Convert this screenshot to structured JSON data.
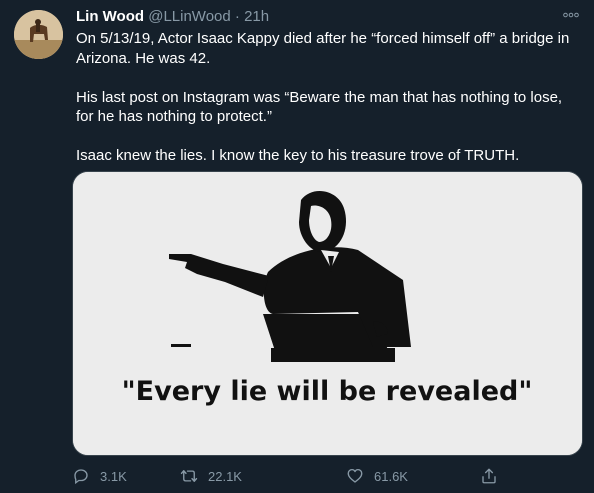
{
  "tweet": {
    "author_name": "Lin Wood",
    "author_handle": "@LLinWood",
    "separator": "·",
    "time": "21h",
    "paragraphs": [
      "On 5/13/19, Actor Isaac Kappy died after he “forced himself off” a bridge in Arizona. He was 42.",
      "His last post on Instagram was “Beware the man that has nothing to lose, for he has nothing to protect.”",
      "Isaac knew the lies. I know the key to his treasure trove of TRUTH."
    ],
    "image_caption": "\"Every lie will be revealed\""
  },
  "actions": {
    "reply_count": "3.1K",
    "retweet_count": "22.1K",
    "like_count": "61.6K"
  },
  "icons": {
    "more": "more-dots-icon",
    "reply": "reply-icon",
    "retweet": "retweet-icon",
    "like": "heart-icon",
    "share": "share-icon"
  },
  "colors": {
    "background": "#15202b",
    "secondary_text": "#8899a6",
    "border": "#38444d"
  }
}
